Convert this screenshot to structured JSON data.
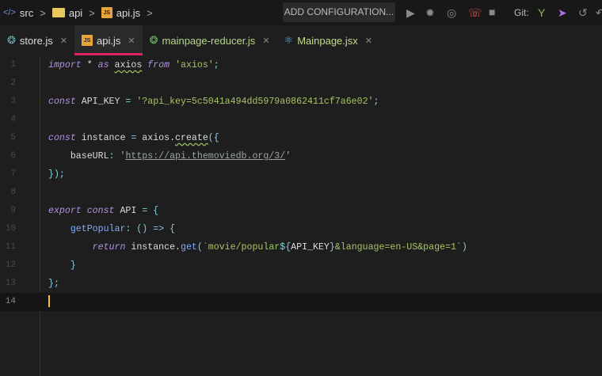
{
  "breadcrumb": {
    "items": [
      "src",
      "api",
      "api.js"
    ]
  },
  "toolbar": {
    "config_label": "ADD CONFIGURATION...",
    "git_label": "Git:"
  },
  "tabs": [
    {
      "label": "store.js",
      "icon": "redux-icon",
      "active": false
    },
    {
      "label": "api.js",
      "icon": "js-icon",
      "active": true
    },
    {
      "label": "mainpage-reducer.js",
      "icon": "redux-icon",
      "active": false
    },
    {
      "label": "Mainpage.jsx",
      "icon": "react-icon",
      "active": false
    }
  ],
  "js_badge": "JS",
  "editor": {
    "current_line": 14,
    "lines": [
      {
        "n": "1",
        "indent": "",
        "tokens": [
          [
            "import",
            "kw"
          ],
          [
            " * ",
            "id"
          ],
          [
            "as",
            "kw"
          ],
          [
            " ",
            "id"
          ],
          [
            "axios",
            "id sq"
          ],
          [
            " ",
            "id"
          ],
          [
            "from",
            "kw"
          ],
          [
            " 'axios'",
            "str"
          ],
          [
            ";",
            "pn"
          ]
        ]
      },
      {
        "n": "2",
        "indent": "",
        "tokens": []
      },
      {
        "n": "3",
        "indent": "",
        "tokens": [
          [
            "const",
            "kw"
          ],
          [
            " API_KEY ",
            "id"
          ],
          [
            "=",
            "pn"
          ],
          [
            " '?api_key=5c5041a494dd5979a0862411cf7a6e02'",
            "str"
          ],
          [
            ";",
            "pn"
          ]
        ]
      },
      {
        "n": "4",
        "indent": "",
        "tokens": []
      },
      {
        "n": "5",
        "indent": "",
        "tokens": [
          [
            "const",
            "kw"
          ],
          [
            " instance ",
            "id"
          ],
          [
            "=",
            "pn"
          ],
          [
            " axios.",
            "id"
          ],
          [
            "create",
            "id sq"
          ],
          [
            "({",
            "pn"
          ]
        ]
      },
      {
        "n": "6",
        "indent": "    ",
        "tokens": [
          [
            "baseURL",
            "id"
          ],
          [
            ": ",
            "pn"
          ],
          [
            "'",
            "str"
          ],
          [
            "https://api.themoviedb.org/3/",
            "url"
          ],
          [
            "'",
            "str"
          ]
        ]
      },
      {
        "n": "7",
        "indent": "",
        "tokens": [
          [
            "});",
            "pn"
          ]
        ]
      },
      {
        "n": "8",
        "indent": "",
        "tokens": []
      },
      {
        "n": "9",
        "indent": "",
        "tokens": [
          [
            "export",
            "kw"
          ],
          [
            " ",
            "id"
          ],
          [
            "const",
            "kw"
          ],
          [
            " API ",
            "id"
          ],
          [
            "= {",
            "pn"
          ]
        ]
      },
      {
        "n": "10",
        "indent": "    ",
        "tokens": [
          [
            "getPopular",
            "fn"
          ],
          [
            ": () => {",
            "pn"
          ]
        ]
      },
      {
        "n": "11",
        "indent": "        ",
        "tokens": [
          [
            "return",
            "kw"
          ],
          [
            " instance.",
            "id"
          ],
          [
            "get",
            "fn"
          ],
          [
            "(",
            "pn"
          ],
          [
            "`movie/popular",
            "str"
          ],
          [
            "${",
            "pn"
          ],
          [
            "API_KEY",
            "id"
          ],
          [
            "}",
            "pn"
          ],
          [
            "&language=en-US&page=1`",
            "str"
          ],
          [
            ")",
            "pn"
          ]
        ]
      },
      {
        "n": "12",
        "indent": "    ",
        "tokens": [
          [
            "}",
            "pn"
          ]
        ]
      },
      {
        "n": "13",
        "indent": "",
        "tokens": [
          [
            "};",
            "pn"
          ]
        ]
      },
      {
        "n": "14",
        "indent": "",
        "tokens": []
      }
    ]
  }
}
